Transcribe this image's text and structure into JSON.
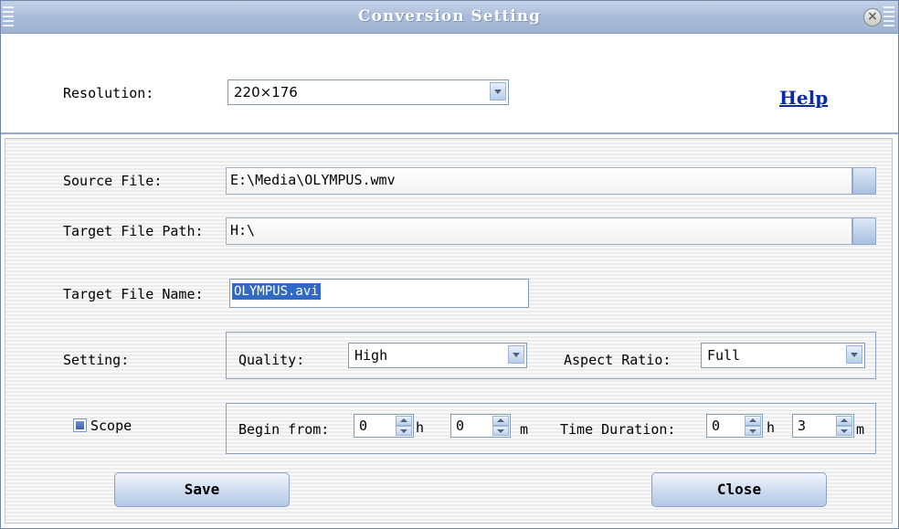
{
  "window": {
    "title": "Conversion Setting"
  },
  "resolution": {
    "label": "Resolution:",
    "value": "220×176"
  },
  "help_link": "Help",
  "source_file": {
    "label": "Source File:",
    "value": "E:\\Media\\OLYMPUS.wmv"
  },
  "target_path": {
    "label": "Target File Path:",
    "value": "H:\\"
  },
  "target_name": {
    "label": "Target File Name:",
    "value": "OLYMPUS.avi"
  },
  "setting": {
    "label": "Setting:",
    "quality_label": "Quality:",
    "quality_value": "High",
    "aspect_label": "Aspect Ratio:",
    "aspect_value": "Full"
  },
  "scope": {
    "label": "Scope",
    "checked": true,
    "begin_label": "Begin from:",
    "begin_hours": "0",
    "hour_unit": "h",
    "begin_minutes": "0",
    "minute_unit": "m",
    "duration_label": "Time Duration:",
    "duration_hours": "0",
    "duration_minutes": "3"
  },
  "buttons": {
    "save": "Save",
    "close": "Close"
  },
  "icons": {
    "close": "close-icon",
    "dropdown": "chevron-down-icon",
    "spin": "spin-arrows-icon"
  }
}
